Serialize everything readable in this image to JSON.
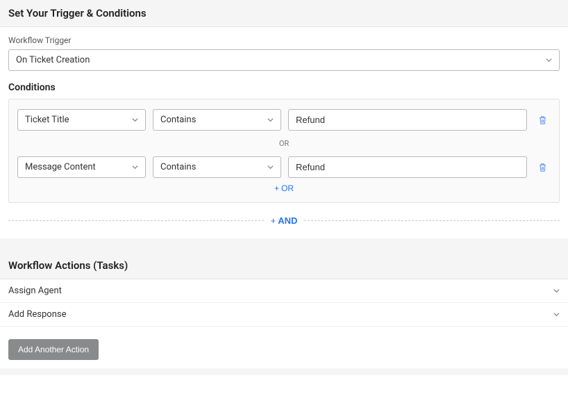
{
  "header": {
    "title": "Set Your Trigger & Conditions"
  },
  "trigger": {
    "label": "Workflow Trigger",
    "value": "On Ticket Creation"
  },
  "conditions": {
    "title": "Conditions",
    "rows": [
      {
        "field": "Ticket Title",
        "operator": "Contains",
        "value": "Refund"
      },
      {
        "field": "Message Content",
        "operator": "Contains",
        "value": "Refund"
      }
    ],
    "or_label": "OR",
    "add_or_label": "OR",
    "and_label": "AND"
  },
  "actions": {
    "title": "Workflow Actions (Tasks)",
    "items": [
      {
        "label": "Assign Agent"
      },
      {
        "label": "Add Response"
      }
    ],
    "add_button": "Add Another Action"
  }
}
